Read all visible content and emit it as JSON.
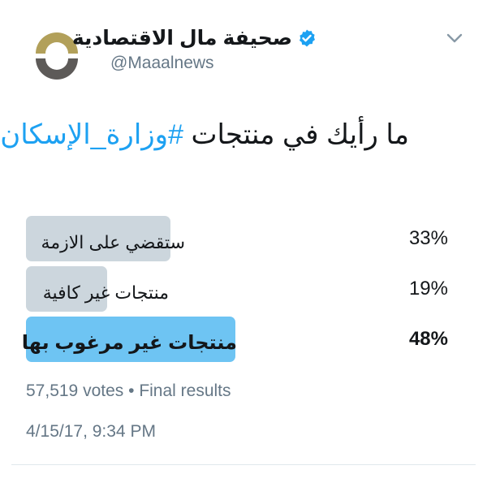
{
  "author": {
    "display_name": "صحيفة مال الاقتصادية",
    "handle": "@Maaalnews",
    "verified": true,
    "avatar_icon": "maaal-logo-icon"
  },
  "menu_icon": "chevron-down-icon",
  "question": {
    "text": "ما رأيك في منتجات ",
    "hashtag": "#وزارة_الإسكان",
    "suffix": " ؟"
  },
  "poll": {
    "options": [
      {
        "label": "ستقضي على الازمة",
        "percent_text": "33%",
        "percent": 33,
        "winner": false
      },
      {
        "label": "منتجات غير كافية",
        "percent_text": "19%",
        "percent": 19,
        "winner": false
      },
      {
        "label": "منتجات غير مرغوب بها",
        "percent_text": "48%",
        "percent": 48,
        "winner": true
      }
    ],
    "votes_text": "57,519 votes",
    "separator": "•",
    "status_text": "Final results"
  },
  "timestamp": "4/15/17, 9:34 PM",
  "colors": {
    "link": "#1da1f2",
    "bar": "#ccd6dd",
    "winner_bar": "#6ec4f3",
    "secondary_text": "#657786",
    "logo_gold": "#b2a05a",
    "logo_dark": "#5d5a58"
  }
}
